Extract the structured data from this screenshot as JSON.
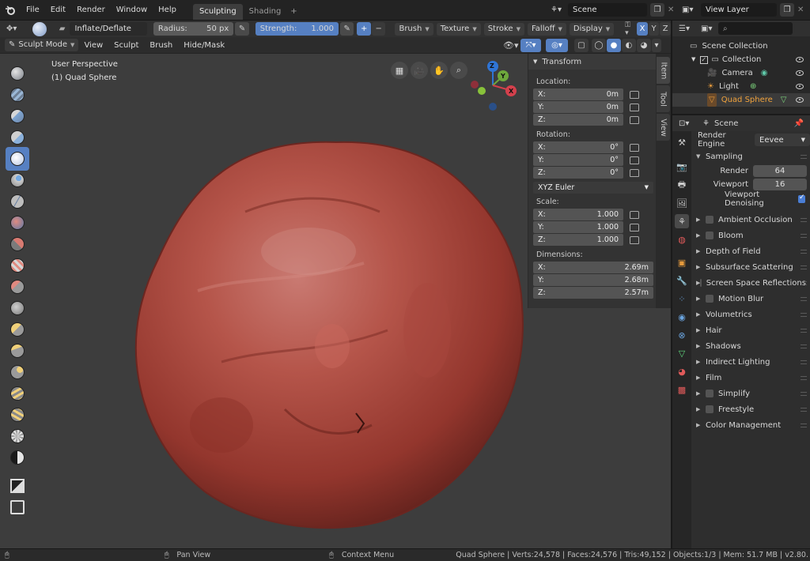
{
  "app": {
    "menu": [
      "File",
      "Edit",
      "Render",
      "Window",
      "Help"
    ],
    "workspace_tabs": [
      {
        "label": "Sculpting",
        "active": true
      },
      {
        "label": "Shading",
        "active": false
      }
    ],
    "add_workspace": "+",
    "scene_name": "Scene",
    "view_layer": "View Layer",
    "search_placeholder": ""
  },
  "tool_header": {
    "brush_name": "Inflate/Deflate",
    "radius_label": "Radius:",
    "radius_value": "50 px",
    "strength_label": "Strength:",
    "strength_value": "1.000",
    "plus": "+",
    "minus": "−",
    "dropdowns": [
      "Brush",
      "Texture",
      "Stroke",
      "Falloff",
      "Display"
    ],
    "sym_axes": [
      "X",
      "Y",
      "Z"
    ]
  },
  "view_header": {
    "mode": "Sculpt Mode",
    "menus": [
      "View",
      "Sculpt",
      "Brush",
      "Hide/Mask"
    ]
  },
  "viewport": {
    "perspective": "User Perspective",
    "object_label": "(1) Quad Sphere",
    "gizmo_axes": [
      "Z",
      "Y",
      "X"
    ]
  },
  "n_panel": {
    "title": "Transform",
    "location_label": "Location:",
    "location": [
      {
        "axis": "X:",
        "value": "0m"
      },
      {
        "axis": "Y:",
        "value": "0m"
      },
      {
        "axis": "Z:",
        "value": "0m"
      }
    ],
    "rotation_label": "Rotation:",
    "rotation": [
      {
        "axis": "X:",
        "value": "0°"
      },
      {
        "axis": "Y:",
        "value": "0°"
      },
      {
        "axis": "Z:",
        "value": "0°"
      }
    ],
    "rotation_mode": "XYZ Euler",
    "scale_label": "Scale:",
    "scale": [
      {
        "axis": "X:",
        "value": "1.000"
      },
      {
        "axis": "Y:",
        "value": "1.000"
      },
      {
        "axis": "Z:",
        "value": "1.000"
      }
    ],
    "dimensions_label": "Dimensions:",
    "dimensions": [
      {
        "axis": "X:",
        "value": "2.69m"
      },
      {
        "axis": "Y:",
        "value": "2.68m"
      },
      {
        "axis": "Z:",
        "value": "2.57m"
      }
    ],
    "tabs": [
      "Item",
      "Tool",
      "View"
    ]
  },
  "outliner": {
    "items": [
      {
        "label": "Scene Collection",
        "indent": 0
      },
      {
        "label": "Collection",
        "indent": 1
      },
      {
        "label": "Camera",
        "indent": 2
      },
      {
        "label": "Light",
        "indent": 2
      },
      {
        "label": "Quad Sphere",
        "indent": 2,
        "selected": true
      }
    ]
  },
  "properties": {
    "context": "Scene",
    "render_engine_label": "Render Engine",
    "render_engine": "Eevee",
    "sampling": {
      "title": "Sampling",
      "render_label": "Render",
      "render_value": "64",
      "viewport_label": "Viewport",
      "viewport_value": "16",
      "denoise_label": "Viewport Denoising"
    },
    "sections": [
      {
        "label": "Ambient Occlusion",
        "checkbox": true
      },
      {
        "label": "Bloom",
        "checkbox": true
      },
      {
        "label": "Depth of Field",
        "checkbox": false
      },
      {
        "label": "Subsurface Scattering",
        "checkbox": false
      },
      {
        "label": "Screen Space Reflections",
        "checkbox": true
      },
      {
        "label": "Motion Blur",
        "checkbox": true
      },
      {
        "label": "Volumetrics",
        "checkbox": false
      },
      {
        "label": "Hair",
        "checkbox": false
      },
      {
        "label": "Shadows",
        "checkbox": false
      },
      {
        "label": "Indirect Lighting",
        "checkbox": false
      },
      {
        "label": "Film",
        "checkbox": false
      },
      {
        "label": "Simplify",
        "checkbox": true
      },
      {
        "label": "Freestyle",
        "checkbox": true
      },
      {
        "label": "Color Management",
        "checkbox": false
      }
    ]
  },
  "status": {
    "pan_view": "Pan View",
    "context_menu": "Context Menu",
    "stats": "Quad Sphere | Verts:24,578 | Faces:24,576 | Tris:49,152 | Objects:1/3 | Mem: 51.7 MB | v2.80."
  },
  "colors": {
    "accent": "#5680c2",
    "viewport_bg": "#3d3d3d",
    "sculpt": "#a8473c",
    "selected_text": "#f0a23c"
  }
}
